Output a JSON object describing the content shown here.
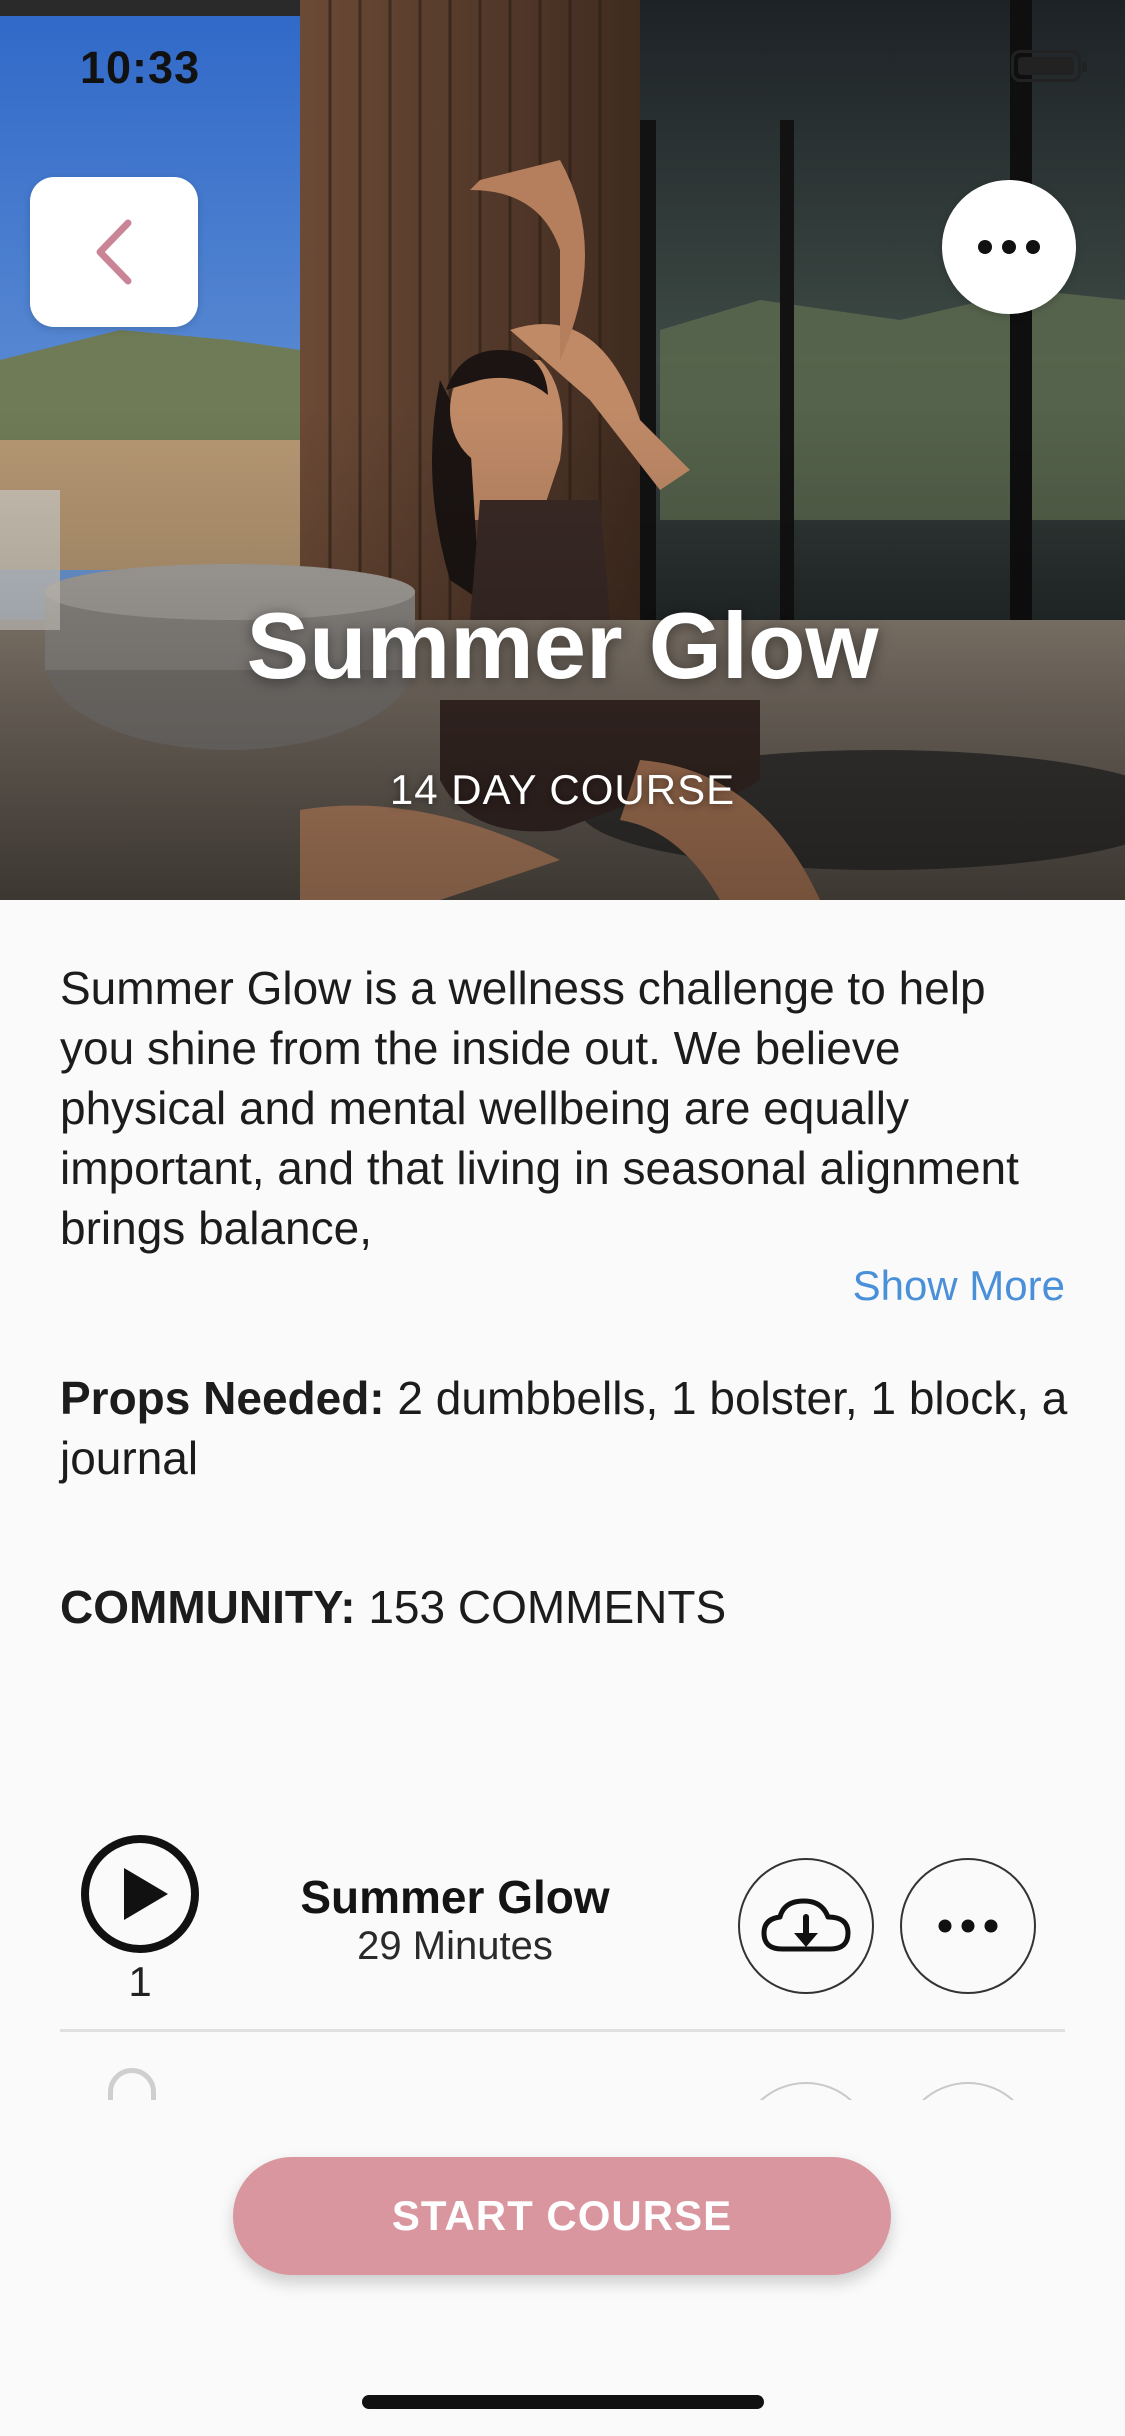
{
  "status_bar": {
    "time": "10:33"
  },
  "hero": {
    "title": "Summer Glow",
    "subtitle": "14 DAY COURSE",
    "back_icon": "chevron-left-icon",
    "more_icon": "ellipsis-icon"
  },
  "description": {
    "text": "Summer Glow is a wellness challenge to help you shine from the inside out. We believe physical and mental wellbeing are equally important, and that living in seasonal alignment brings balance,",
    "show_more_label": "Show More"
  },
  "props": {
    "label": "Props Needed:",
    "value": " 2 dumbbells, 1 bolster, 1 block, a journal"
  },
  "community": {
    "label": "COMMUNITY:",
    "value": " 153 COMMENTS"
  },
  "sessions": [
    {
      "index": "1",
      "title": "Summer Glow",
      "duration": "29 Minutes",
      "play_icon": "play-icon",
      "download_icon": "cloud-download-icon",
      "more_icon": "ellipsis-icon"
    }
  ],
  "cta": {
    "start_label": "START COURSE"
  },
  "colors": {
    "accent_pink": "#d9969f",
    "back_chevron": "#c98595",
    "link_blue": "#4a90d9",
    "background": "#fafafa"
  }
}
